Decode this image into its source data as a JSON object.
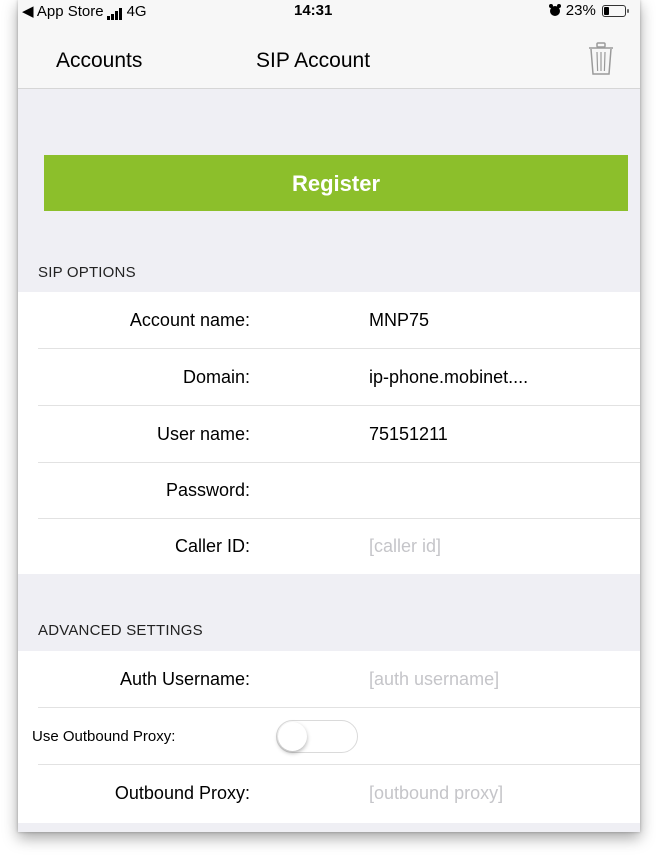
{
  "status_bar": {
    "carrier": "◀ App Store",
    "network": "4G",
    "time": "14:31",
    "alarm_icon": "alarm-clock-icon",
    "battery_percent": "23%",
    "battery_level": 0.23
  },
  "nav": {
    "back_label": "Accounts",
    "title": "SIP Account",
    "trash_icon": "trash-icon"
  },
  "register": {
    "label": "Register",
    "color": "#8cbf2b"
  },
  "sip_options": {
    "header": "SIP OPTIONS",
    "rows": [
      {
        "label": "Account name:",
        "value": "MNP75",
        "placeholder": ""
      },
      {
        "label": "Domain:",
        "value": "ip-phone.mobinet....",
        "placeholder": ""
      },
      {
        "label": "User name:",
        "value": "75151211",
        "placeholder": ""
      },
      {
        "label": "Password:",
        "value": "",
        "placeholder": ""
      },
      {
        "label": "Caller ID:",
        "value": "",
        "placeholder": "[caller id]"
      }
    ]
  },
  "advanced": {
    "header": "ADVANCED SETTINGS",
    "auth_username": {
      "label": "Auth Username:",
      "value": "",
      "placeholder": "[auth username]"
    },
    "use_outbound_proxy": {
      "label": "Use Outbound Proxy:",
      "on": false
    },
    "outbound_proxy": {
      "label": "Outbound Proxy:",
      "value": "",
      "placeholder": "[outbound proxy]"
    }
  }
}
